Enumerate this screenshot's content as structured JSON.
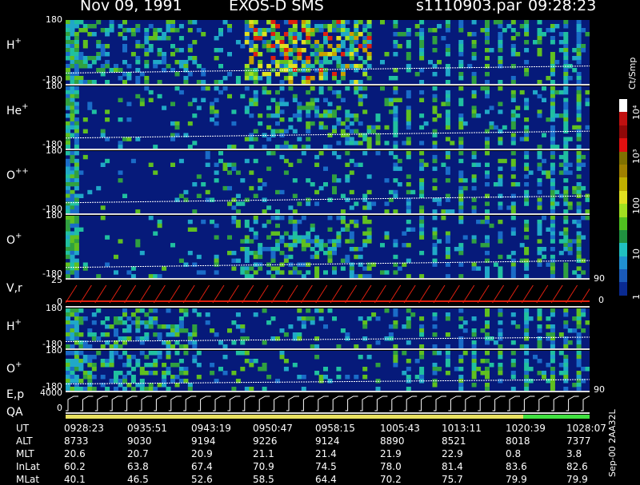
{
  "header": {
    "date": "Nov 09, 1991",
    "instrument": "EXOS-D SMS",
    "file": "s1110903.par",
    "time": "09:28:23"
  },
  "colors": {
    "background": "#000000",
    "panel_fill": "#061a7a",
    "trace": "#ffffff",
    "vr_trace": "#e02010",
    "qa_bar": "#e8e060",
    "qa_bar_end": "#40e040"
  },
  "panels": [
    {
      "label": "H",
      "sup": "+",
      "top_tick": "180",
      "bottom_tick": "-180"
    },
    {
      "label": "He",
      "sup": "+",
      "top_tick": "180",
      "bottom_tick": "-180"
    },
    {
      "label": "O",
      "sup": "++",
      "top_tick": "180",
      "bottom_tick": "-180"
    },
    {
      "label": "O",
      "sup": "+",
      "top_tick": "180",
      "bottom_tick": "-180"
    },
    {
      "label": "V,r",
      "sup": "",
      "top_tick": "25",
      "bottom_tick": "0",
      "right_tick": "90",
      "right_tick_bottom": "0"
    },
    {
      "label": "H",
      "sup": "+",
      "top_tick": "180",
      "bottom_tick": "-180"
    },
    {
      "label": "O",
      "sup": "+",
      "top_tick": "180",
      "bottom_tick": "-180",
      "right_tick": "90"
    },
    {
      "label": "E,p",
      "sup": "",
      "top_tick": "4000",
      "bottom_tick": "0"
    }
  ],
  "qa_label": "QA",
  "colorbar": {
    "unit": "Ct/Smp",
    "ticks": [
      "10⁴",
      "10³",
      "100",
      "10",
      "1"
    ]
  },
  "side_note": "Sep-00  2AA32L",
  "table": {
    "rows": [
      {
        "name": "UT",
        "values": [
          "0928:23",
          "0935:51",
          "0943:19",
          "0950:47",
          "0958:15",
          "1005:43",
          "1013:11",
          "1020:39",
          "1028:07"
        ]
      },
      {
        "name": "ALT",
        "values": [
          "8733",
          "9030",
          "9194",
          "9226",
          "9124",
          "8890",
          "8521",
          "8018",
          "7377"
        ]
      },
      {
        "name": "MLT",
        "values": [
          "20.6",
          "20.7",
          "20.9",
          "21.1",
          "21.4",
          "21.9",
          "22.9",
          "0.8",
          "3.8"
        ]
      },
      {
        "name": "InLat",
        "values": [
          "60.2",
          "63.8",
          "67.4",
          "70.9",
          "74.5",
          "78.0",
          "81.4",
          "83.6",
          "82.6"
        ]
      },
      {
        "name": "MLat",
        "values": [
          "40.1",
          "46.5",
          "52.6",
          "58.5",
          "64.4",
          "70.2",
          "75.7",
          "79.9",
          "79.9"
        ]
      }
    ]
  },
  "chart_data": {
    "type": "heatmap",
    "title": "Nov 09, 1991   EXOS-D SMS",
    "x_ticks": [
      "0928:23",
      "0935:51",
      "0943:19",
      "0950:47",
      "0958:15",
      "1005:43",
      "1013:11",
      "1020:39",
      "1028:07"
    ],
    "panels": [
      "H+",
      "He+",
      "O++",
      "O+",
      "V,r",
      "H+",
      "O+",
      "E,p"
    ],
    "y_range_pitch": [
      -180,
      180
    ],
    "vr_range": [
      0,
      25
    ],
    "ep_range": [
      0,
      4000
    ],
    "colorbar_unit": "Ct/Smp",
    "colorbar_range": [
      1,
      10000
    ],
    "colorbar_scale": "log"
  }
}
